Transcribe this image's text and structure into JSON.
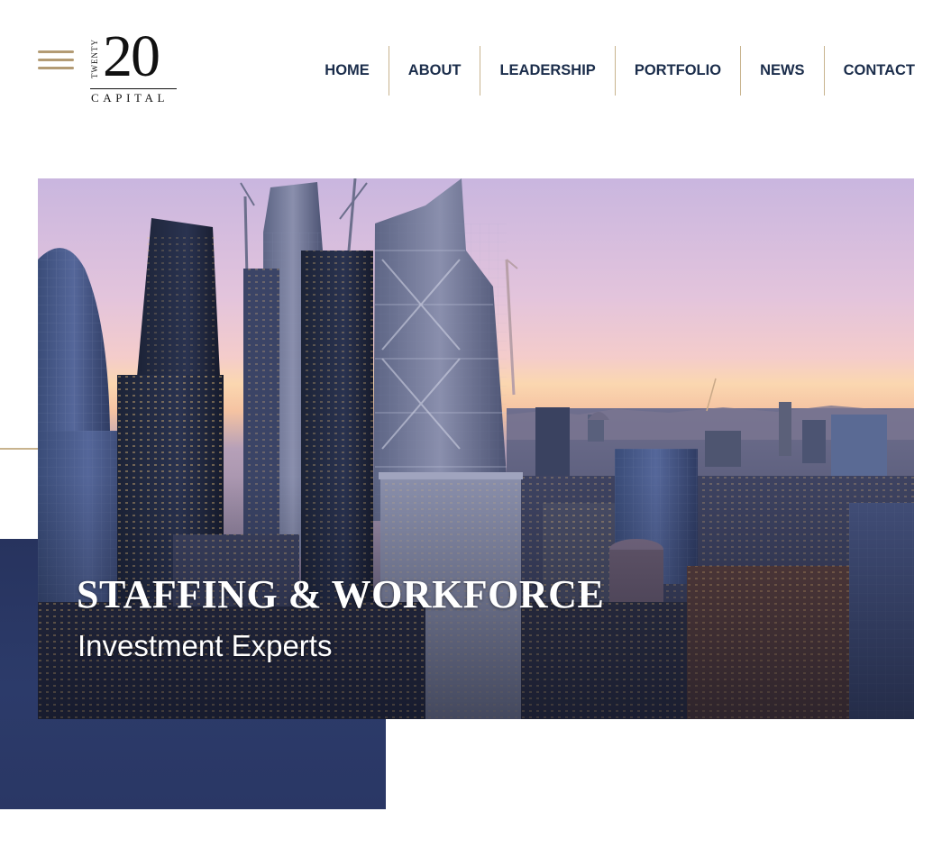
{
  "logo": {
    "small_text": "TWENTY",
    "number": "20",
    "caption": "CAPITAL"
  },
  "nav": {
    "items": [
      {
        "label": "HOME"
      },
      {
        "label": "ABOUT"
      },
      {
        "label": "LEADERSHIP"
      },
      {
        "label": "PORTFOLIO"
      },
      {
        "label": "NEWS"
      },
      {
        "label": "CONTACT"
      }
    ]
  },
  "hero": {
    "title": "STAFFING & WORKFORCE",
    "subtitle": "Investment Experts",
    "image": "london-city-skyline-at-sunset"
  },
  "icons": {
    "menu": "hamburger-menu-icon"
  },
  "colors": {
    "navy": "#1b2d4b",
    "gold": "#b39b74",
    "block": "#2a3765"
  }
}
